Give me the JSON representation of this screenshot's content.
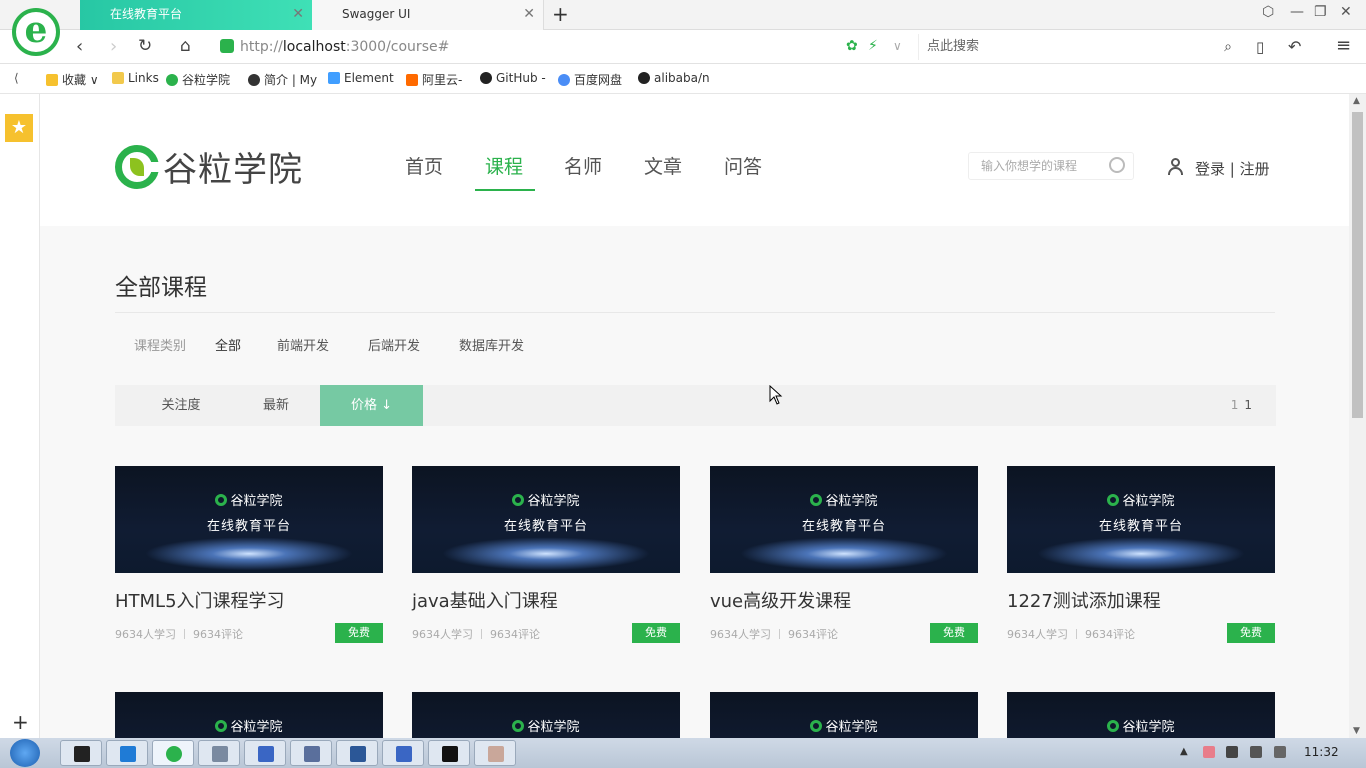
{
  "browser": {
    "tabs": [
      {
        "title": "在线教育平台",
        "active": true
      },
      {
        "title": "Swagger UI",
        "active": false
      }
    ],
    "new_tab": "+",
    "url_prefix": "http://",
    "url_host": "localhost",
    "url_rest": ":3000/course#",
    "search_placeholder": "点此搜索",
    "bookmarks": [
      {
        "label": "收藏",
        "icon": "star-icon"
      },
      {
        "label": "Links",
        "icon": "folder-icon"
      },
      {
        "label": "谷粒学院",
        "icon": "guli-icon"
      },
      {
        "label": "简介 | My",
        "icon": "bird-icon"
      },
      {
        "label": "Element",
        "icon": "element-icon"
      },
      {
        "label": "阿里云-",
        "icon": "aliyun-icon"
      },
      {
        "label": "GitHub -",
        "icon": "github-icon"
      },
      {
        "label": "百度网盘",
        "icon": "baidu-icon"
      },
      {
        "label": "alibaba/n",
        "icon": "github-icon"
      }
    ]
  },
  "site": {
    "brand": "谷粒学院",
    "nav": [
      "首页",
      "课程",
      "名师",
      "文章",
      "问答"
    ],
    "active_nav": "课程",
    "search_placeholder": "输入你想学的课程",
    "login": "登录",
    "divider": "|",
    "register": "注册"
  },
  "course_page": {
    "title": "全部课程",
    "category_label": "课程类别",
    "categories": [
      "全部",
      "前端开发",
      "后端开发",
      "数据库开发"
    ],
    "sorts": [
      "关注度",
      "最新",
      "价格 ↓"
    ],
    "active_sort": "价格 ↓",
    "pager_current": "1",
    "pager_total": "1",
    "cover_brand": "谷粒学院",
    "cover_subtitle": "在线教育平台",
    "courses": [
      {
        "title": "HTML5入门课程学习",
        "learners": "9634人学习",
        "comments": "9634评论",
        "price": "免费"
      },
      {
        "title": "java基础入门课程",
        "learners": "9634人学习",
        "comments": "9634评论",
        "price": "免费"
      },
      {
        "title": "vue高级开发课程",
        "learners": "9634人学习",
        "comments": "9634评论",
        "price": "免费"
      },
      {
        "title": "1227测试添加课程",
        "learners": "9634人学习",
        "comments": "9634评论",
        "price": "免费"
      }
    ]
  },
  "taskbar": {
    "clock": "11:32"
  },
  "colors": {
    "accent": "#2bb24c",
    "sort_active": "#76c9a3",
    "tab_active": "#27c7a4"
  }
}
